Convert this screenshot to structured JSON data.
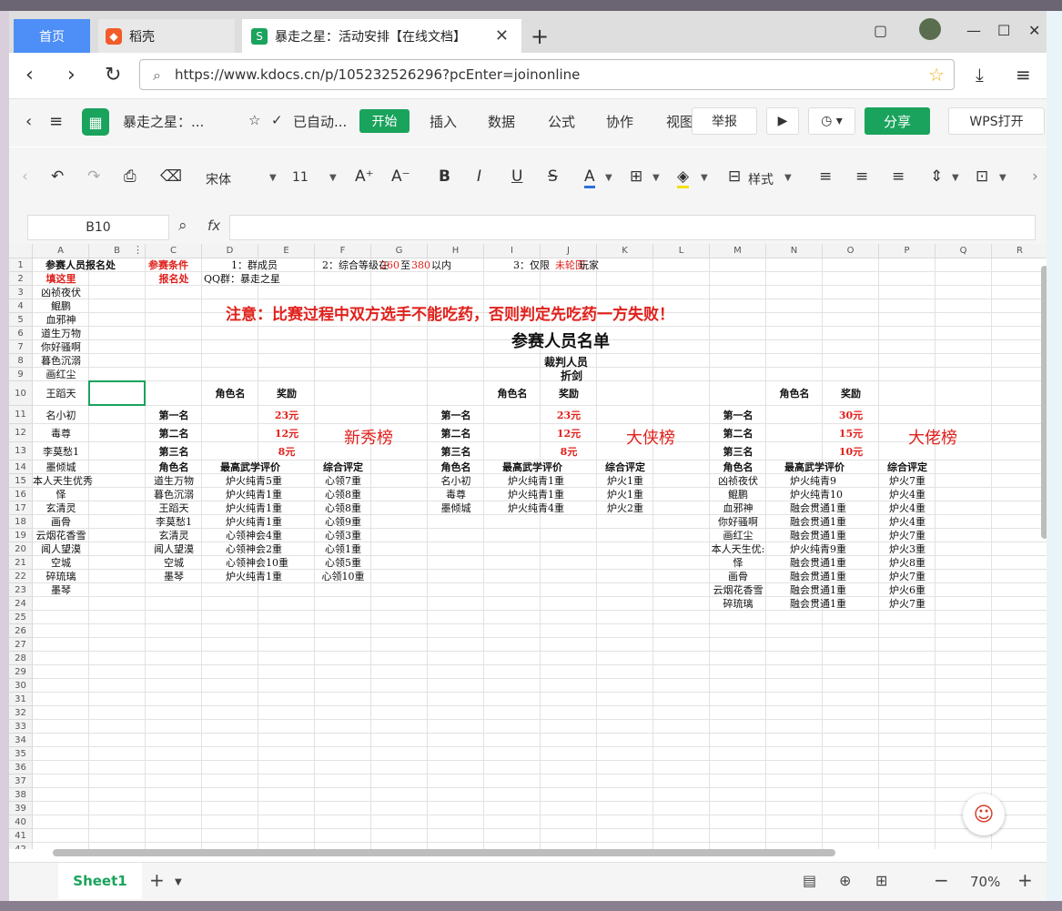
{
  "browser": {
    "tabs": [
      {
        "label": "首页"
      },
      {
        "label": "稻壳"
      },
      {
        "label": "暴走之星：活动安排【在线文档】"
      }
    ],
    "url": "https://www.kdocs.cn/p/105232526296?pcEnter=joinonline"
  },
  "app": {
    "doc_title": "暴走之星：...",
    "autosave": "已自动...",
    "menu": [
      "开始",
      "插入",
      "数据",
      "公式",
      "协作",
      "视图"
    ],
    "report": "举报",
    "share": "分享",
    "wps_open": "WPS打开"
  },
  "format_toolbar": {
    "font": "宋体",
    "size": "11",
    "style_label": "样式"
  },
  "formula_bar": {
    "cell_ref": "B10",
    "fx": "fx"
  },
  "columns": [
    "A",
    "B",
    "C",
    "D",
    "E",
    "F",
    "G",
    "H",
    "I",
    "J",
    "K",
    "L",
    "M",
    "N",
    "O",
    "P",
    "Q",
    "R"
  ],
  "rows": [
    "1",
    "2",
    "3",
    "4",
    "5",
    "6",
    "7",
    "8",
    "9",
    "10",
    "11",
    "12",
    "13",
    "14",
    "15",
    "16",
    "17",
    "18",
    "19",
    "20",
    "21",
    "22",
    "23",
    "24",
    "25",
    "26",
    "27",
    "28",
    "29",
    "30",
    "31",
    "32",
    "33",
    "34",
    "35",
    "36",
    "37",
    "38",
    "39",
    "40",
    "41",
    "42"
  ],
  "cells": [
    {
      "id": "a1",
      "text": "参赛人员报名处",
      "bold": true
    },
    {
      "id": "c1",
      "text": "参赛条件",
      "red": true,
      "bold": true
    },
    {
      "id": "d1",
      "text": "1：群成员"
    },
    {
      "id": "f1a",
      "text": "2：综合等级在"
    },
    {
      "id": "f1b",
      "text": "260",
      "red": true
    },
    {
      "id": "f1c",
      "text": "至"
    },
    {
      "id": "f1d",
      "text": "380",
      "red": true
    },
    {
      "id": "f1e",
      "text": "以内"
    },
    {
      "id": "i1a",
      "text": "3：仅限"
    },
    {
      "id": "i1b",
      "text": "未轮回",
      "red": true
    },
    {
      "id": "i1c",
      "text": "玩家"
    },
    {
      "id": "a2",
      "text": "填这里",
      "red": true,
      "bold": true
    },
    {
      "id": "c2",
      "text": "报名处",
      "red": true,
      "bold": true
    },
    {
      "id": "d2",
      "text": "QQ群：暴走之星"
    },
    {
      "id": "a3",
      "text": "凶祯夜伏"
    },
    {
      "id": "a4",
      "text": "鲲鹏"
    },
    {
      "id": "a5",
      "text": "血邪神"
    },
    {
      "id": "a6",
      "text": "道生万物"
    },
    {
      "id": "a7",
      "text": "你好骚啊"
    },
    {
      "id": "a8",
      "text": "暮色沉溺"
    },
    {
      "id": "a9",
      "text": "画红尘"
    },
    {
      "id": "a10",
      "text": "王蹈天"
    },
    {
      "id": "a11",
      "text": "名小初"
    },
    {
      "id": "a12",
      "text": "毒尊"
    },
    {
      "id": "a13",
      "text": "李莫愁1"
    },
    {
      "id": "a14",
      "text": "墨倾城"
    },
    {
      "id": "a15",
      "text": "本人天生优秀"
    },
    {
      "id": "a16",
      "text": "怿"
    },
    {
      "id": "a17",
      "text": "玄清灵"
    },
    {
      "id": "a18",
      "text": "画骨"
    },
    {
      "id": "a19",
      "text": "云烟花香雪"
    },
    {
      "id": "a20",
      "text": "闻人望漠"
    },
    {
      "id": "a21",
      "text": "空城"
    },
    {
      "id": "a22",
      "text": "碎琉璃"
    },
    {
      "id": "a23",
      "text": "墨琴"
    },
    {
      "id": "notice",
      "text": "注意：比赛过程中双方选手不能吃药，否则判定先吃药一方失败！",
      "red": true,
      "big": true
    },
    {
      "id": "list_title",
      "text": "参赛人员名单",
      "big": true
    },
    {
      "id": "judge",
      "text": "裁判人员",
      "bold": true
    },
    {
      "id": "judge_name",
      "text": "折剑",
      "bold": true
    },
    {
      "id": "d10",
      "text": "角色名",
      "bold": true
    },
    {
      "id": "e10",
      "text": "奖励",
      "bold": true
    },
    {
      "id": "i10",
      "text": "角色名",
      "bold": true
    },
    {
      "id": "j10",
      "text": "奖励",
      "bold": true
    },
    {
      "id": "n10",
      "text": "角色名",
      "bold": true
    },
    {
      "id": "o10",
      "text": "奖励",
      "bold": true
    },
    {
      "id": "c11",
      "text": "第一名",
      "bold": true
    },
    {
      "id": "e11",
      "text": "23元",
      "red": true,
      "bold": true
    },
    {
      "id": "h11",
      "text": "第一名",
      "bold": true
    },
    {
      "id": "j11",
      "text": "23元",
      "red": true,
      "bold": true
    },
    {
      "id": "m11",
      "text": "第一名",
      "bold": true
    },
    {
      "id": "o11",
      "text": "30元",
      "red": true,
      "bold": true
    },
    {
      "id": "c12",
      "text": "第二名",
      "bold": true
    },
    {
      "id": "e12",
      "text": "12元",
      "red": true,
      "bold": true
    },
    {
      "id": "h12",
      "text": "第二名",
      "bold": true
    },
    {
      "id": "j12",
      "text": "12元",
      "red": true,
      "bold": true
    },
    {
      "id": "m12",
      "text": "第二名",
      "bold": true
    },
    {
      "id": "o12",
      "text": "15元",
      "red": true,
      "bold": true
    },
    {
      "id": "c13",
      "text": "第三名",
      "bold": true
    },
    {
      "id": "e13",
      "text": "8元",
      "red": true,
      "bold": true
    },
    {
      "id": "h13",
      "text": "第三名",
      "bold": true
    },
    {
      "id": "j13",
      "text": "8元",
      "red": true,
      "bold": true
    },
    {
      "id": "m13",
      "text": "第三名",
      "bold": true
    },
    {
      "id": "o13",
      "text": "10元",
      "red": true,
      "bold": true
    },
    {
      "id": "board1",
      "text": "新秀榜",
      "red": true,
      "large": true
    },
    {
      "id": "board2",
      "text": "大侠榜",
      "red": true,
      "large": true
    },
    {
      "id": "board3",
      "text": "大佬榜",
      "red": true,
      "large": true
    },
    {
      "id": "c14",
      "text": "角色名",
      "bold": true
    },
    {
      "id": "d14",
      "text": "最高武学评价",
      "bold": true
    },
    {
      "id": "f14",
      "text": "综合评定",
      "bold": true
    },
    {
      "id": "h14",
      "text": "角色名",
      "bold": true
    },
    {
      "id": "i14",
      "text": "最高武学评价",
      "bold": true
    },
    {
      "id": "k14",
      "text": "综合评定",
      "bold": true
    },
    {
      "id": "m14",
      "text": "角色名",
      "bold": true
    },
    {
      "id": "n14",
      "text": "最高武学评价",
      "bold": true
    },
    {
      "id": "p14",
      "text": "综合评定",
      "bold": true
    },
    {
      "id": "c15",
      "text": "道生万物"
    },
    {
      "id": "d15",
      "text": "炉火纯青5重"
    },
    {
      "id": "f15",
      "text": "心领7重"
    },
    {
      "id": "c16",
      "text": "暮色沉溺"
    },
    {
      "id": "d16",
      "text": "炉火纯青1重"
    },
    {
      "id": "f16",
      "text": "心领8重"
    },
    {
      "id": "c17",
      "text": "王蹈天"
    },
    {
      "id": "d17",
      "text": "炉火纯青1重"
    },
    {
      "id": "f17",
      "text": "心领8重"
    },
    {
      "id": "c18",
      "text": "李莫愁1"
    },
    {
      "id": "d18",
      "text": "炉火纯青1重"
    },
    {
      "id": "f18",
      "text": "心领9重"
    },
    {
      "id": "c19",
      "text": "玄清灵"
    },
    {
      "id": "d19",
      "text": "心领神会4重"
    },
    {
      "id": "f19",
      "text": "心领3重"
    },
    {
      "id": "c20",
      "text": "闻人望漠"
    },
    {
      "id": "d20",
      "text": "心领神会2重"
    },
    {
      "id": "f20",
      "text": "心领1重"
    },
    {
      "id": "c21",
      "text": "空城"
    },
    {
      "id": "d21",
      "text": "心领神会10重"
    },
    {
      "id": "f21",
      "text": "心领5重"
    },
    {
      "id": "c22",
      "text": "墨琴"
    },
    {
      "id": "d22",
      "text": "炉火纯青1重"
    },
    {
      "id": "f22",
      "text": "心领10重"
    },
    {
      "id": "h15",
      "text": "名小初"
    },
    {
      "id": "i15",
      "text": "炉火纯青1重"
    },
    {
      "id": "k15",
      "text": "炉火1重"
    },
    {
      "id": "h16",
      "text": "毒尊"
    },
    {
      "id": "i16",
      "text": "炉火纯青1重"
    },
    {
      "id": "k16",
      "text": "炉火1重"
    },
    {
      "id": "h17",
      "text": "墨倾城"
    },
    {
      "id": "i17",
      "text": "炉火纯青4重"
    },
    {
      "id": "k17",
      "text": "炉火2重"
    },
    {
      "id": "m15",
      "text": "凶祯夜伏"
    },
    {
      "id": "n15",
      "text": "炉火纯青9"
    },
    {
      "id": "p15",
      "text": "炉火7重"
    },
    {
      "id": "m16",
      "text": "鲲鹏"
    },
    {
      "id": "n16",
      "text": "炉火纯青10"
    },
    {
      "id": "p16",
      "text": "炉火4重"
    },
    {
      "id": "m17",
      "text": "血邪神"
    },
    {
      "id": "n17",
      "text": "融会贯通1重"
    },
    {
      "id": "p17",
      "text": "炉火4重"
    },
    {
      "id": "m18",
      "text": "你好骚啊"
    },
    {
      "id": "n18",
      "text": "融会贯通1重"
    },
    {
      "id": "p18",
      "text": "炉火4重"
    },
    {
      "id": "m19",
      "text": "画红尘"
    },
    {
      "id": "n19",
      "text": "融会贯通1重"
    },
    {
      "id": "p19",
      "text": "炉火7重"
    },
    {
      "id": "m20",
      "text": "本人天生优:"
    },
    {
      "id": "n20",
      "text": "炉火纯青9重"
    },
    {
      "id": "p20",
      "text": "炉火3重"
    },
    {
      "id": "m21",
      "text": "怿"
    },
    {
      "id": "n21",
      "text": "融会贯通1重"
    },
    {
      "id": "p21",
      "text": "炉火8重"
    },
    {
      "id": "m22",
      "text": "画骨"
    },
    {
      "id": "n22",
      "text": "融会贯通1重"
    },
    {
      "id": "p22",
      "text": "炉火7重"
    },
    {
      "id": "m23",
      "text": "云烟花香雪"
    },
    {
      "id": "n23",
      "text": "融会贯通1重"
    },
    {
      "id": "p23",
      "text": "炉火6重"
    },
    {
      "id": "m24",
      "text": "碎琉璃"
    },
    {
      "id": "n24",
      "text": "融会贯通1重"
    },
    {
      "id": "p24",
      "text": "炉火7重"
    }
  ],
  "bottom": {
    "sheet": "Sheet1",
    "zoom": "70%"
  },
  "colors": {
    "accent": "#1aa35c",
    "red": "#e0201b",
    "tab_blue": "#4d8ef7"
  }
}
